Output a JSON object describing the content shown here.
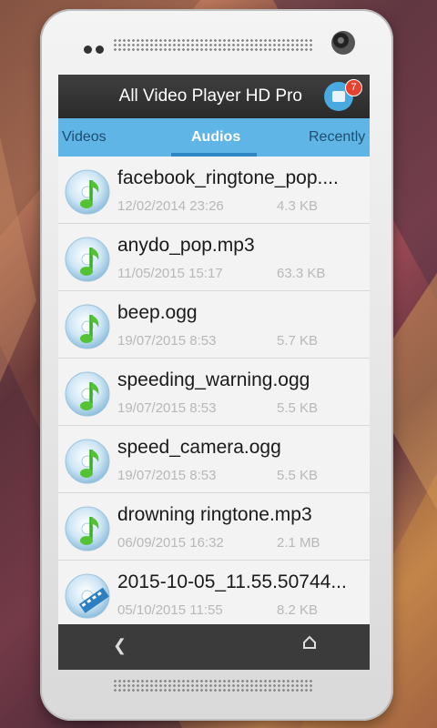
{
  "app": {
    "title": "All Video Player HD Pro",
    "badge_count": "7"
  },
  "tabs": [
    {
      "label": "Videos",
      "active": false
    },
    {
      "label": "Audios",
      "active": true
    },
    {
      "label": "Recently",
      "active": false
    }
  ],
  "files": [
    {
      "name": "facebook_ringtone_pop....",
      "date": "12/02/2014 23:26",
      "size": "4.3 KB",
      "icon": "audio-disc-icon"
    },
    {
      "name": "anydo_pop.mp3",
      "date": "11/05/2015 15:17",
      "size": "63.3 KB",
      "icon": "audio-disc-icon"
    },
    {
      "name": "beep.ogg",
      "date": "19/07/2015 8:53",
      "size": "5.7 KB",
      "icon": "audio-disc-icon"
    },
    {
      "name": "speeding_warning.ogg",
      "date": "19/07/2015 8:53",
      "size": "5.5 KB",
      "icon": "audio-disc-icon"
    },
    {
      "name": "speed_camera.ogg",
      "date": "19/07/2015 8:53",
      "size": "5.5 KB",
      "icon": "audio-disc-icon"
    },
    {
      "name": "drowning ringtone.mp3",
      "date": "06/09/2015 16:32",
      "size": "2.1 MB",
      "icon": "audio-disc-icon"
    },
    {
      "name": "2015-10-05_11.55.50744...",
      "date": "05/10/2015 11:55",
      "size": "8.2 KB",
      "icon": "video-disc-icon"
    }
  ],
  "nav": {
    "back_icon": "back-chevron-icon",
    "home_icon": "home-icon"
  },
  "colors": {
    "tab_bar": "#5fb5e6",
    "tab_indicator": "#2f86c4",
    "badge": "#e8412e",
    "icon_button": "#4aa9de"
  }
}
